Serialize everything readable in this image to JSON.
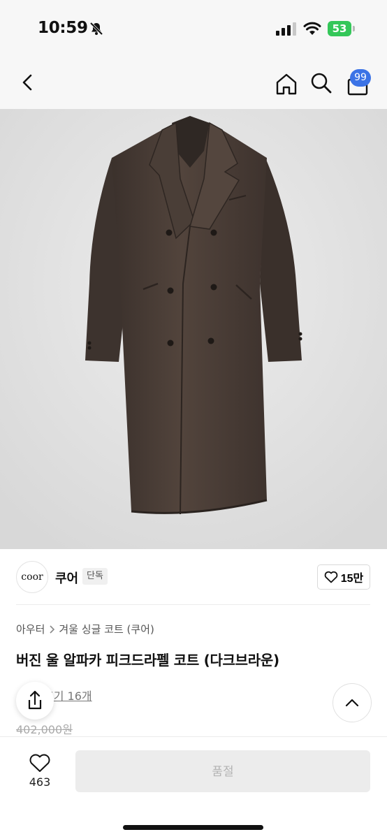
{
  "status_bar": {
    "time": "10:59",
    "battery": "53"
  },
  "nav": {
    "cart_count": "99"
  },
  "brand": {
    "logo_text": "coor",
    "name": "쿠어",
    "tag": "단독",
    "likes": "15만"
  },
  "breadcrumb": {
    "category": "아우터",
    "subcategory": "겨울 싱글 코트 (쿠어)"
  },
  "product": {
    "title": "버진 울 알파카 피크드라펠 코트 (다크브라운)",
    "review_text": "후기 16개",
    "original_price": "402,000원"
  },
  "bottom_bar": {
    "wish_count": "463",
    "action_label": "품절"
  },
  "colors": {
    "accent": "#3b73e6",
    "coat": "#4b3e37",
    "battery": "#34c759"
  }
}
